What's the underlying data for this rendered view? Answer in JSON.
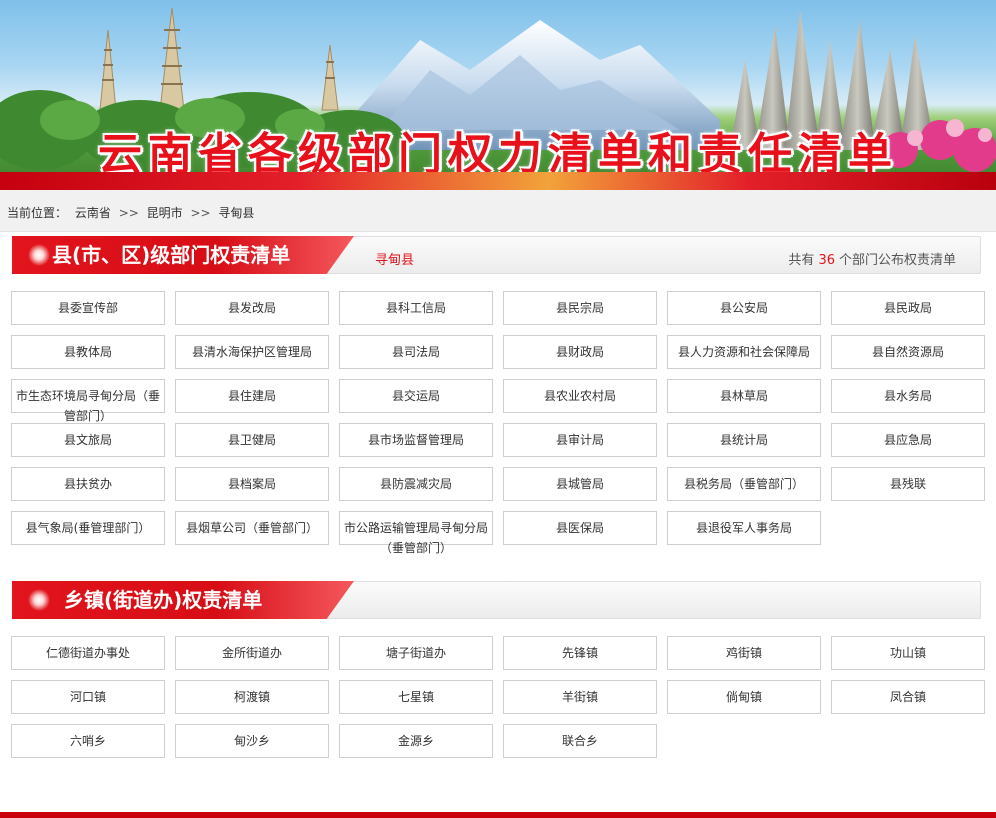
{
  "banner": {
    "title": "云南省各级部门权力清单和责任清单"
  },
  "breadcrumb": {
    "label": "当前位置：",
    "items": [
      "云南省",
      "昆明市",
      "寻甸县"
    ],
    "separator": ">>"
  },
  "section_county": {
    "title": "县(市、区)级部门权责清单",
    "county": "寻甸县",
    "count_prefix": "共有",
    "count": "36",
    "count_suffix": "个部门公布权责清单"
  },
  "departments": [
    "县委宣传部",
    "县发改局",
    "县科工信局",
    "县民宗局",
    "县公安局",
    "县民政局",
    "县教体局",
    "县清水海保护区管理局",
    "县司法局",
    "县财政局",
    "县人力资源和社会保障局",
    "县自然资源局",
    "市生态环境局寻甸分局（垂管部门）",
    "县住建局",
    "县交运局",
    "县农业农村局",
    "县林草局",
    "县水务局",
    "县文旅局",
    "县卫健局",
    "县市场监督管理局",
    "县审计局",
    "县统计局",
    "县应急局",
    "县扶贫办",
    "县档案局",
    "县防震减灾局",
    "县城管局",
    "县税务局（垂管部门）",
    "县残联",
    "县气象局(垂管理部门）",
    "县烟草公司（垂管部门）",
    "市公路运输管理局寻甸分局（垂管部门）",
    "县医保局",
    "县退役军人事务局"
  ],
  "section_town": {
    "title": "乡镇(街道办)权责清单"
  },
  "towns": [
    "仁德街道办事处",
    "金所街道办",
    "塘子街道办",
    "先锋镇",
    "鸡街镇",
    "功山镇",
    "河口镇",
    "柯渡镇",
    "七星镇",
    "羊街镇",
    "倘甸镇",
    "凤合镇",
    "六哨乡",
    "甸沙乡",
    "金源乡",
    "联合乡"
  ],
  "colors": {
    "accent_red": "#e2141d",
    "footer_red": "#c8000c"
  }
}
